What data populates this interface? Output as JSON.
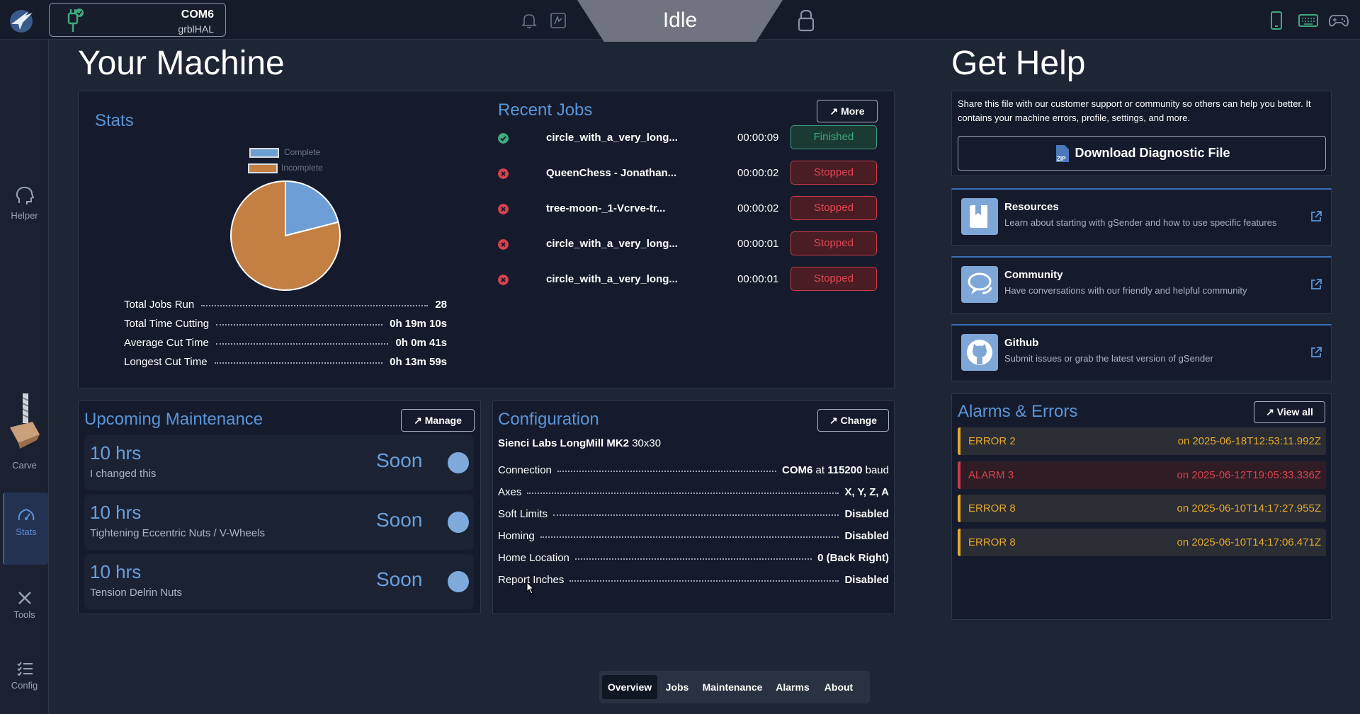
{
  "header": {
    "connection": {
      "port": "COM6",
      "firmware": "grblHAL"
    },
    "state": "Idle"
  },
  "sidebar": {
    "items": [
      {
        "label": "Helper",
        "icon": "helper-icon"
      },
      {
        "label": "Carve",
        "icon": "carve-icon"
      },
      {
        "label": "Stats",
        "icon": "gauge-icon",
        "active": true
      },
      {
        "label": "Tools",
        "icon": "tools-icon"
      },
      {
        "label": "Config",
        "icon": "config-icon"
      }
    ]
  },
  "machine": {
    "title": "Your Machine",
    "stats": {
      "title": "Stats",
      "legend": {
        "complete": "Complete",
        "incomplete": "Incomplete"
      },
      "rows": [
        {
          "label": "Total Jobs Run",
          "value": "28"
        },
        {
          "label": "Total Time Cutting",
          "value": "0h 19m 10s"
        },
        {
          "label": "Average Cut Time",
          "value": "0h 0m 41s"
        },
        {
          "label": "Longest Cut Time",
          "value": "0h 13m 59s"
        }
      ]
    },
    "recent_jobs": {
      "title": "Recent Jobs",
      "more_label": "More",
      "jobs": [
        {
          "name": "circle_with_a_very_long...",
          "time": "00:00:09",
          "status": "Finished"
        },
        {
          "name": "QueenChess - Jonathan...",
          "time": "00:00:02",
          "status": "Stopped"
        },
        {
          "name": "tree-moon-_1-Vcrve-tr...",
          "time": "00:00:02",
          "status": "Stopped"
        },
        {
          "name": "circle_with_a_very_long...",
          "time": "00:00:01",
          "status": "Stopped"
        },
        {
          "name": "circle_with_a_very_long...",
          "time": "00:00:01",
          "status": "Stopped"
        }
      ]
    },
    "maintenance": {
      "title": "Upcoming Maintenance",
      "manage_label": "Manage",
      "items": [
        {
          "hours": "10 hrs",
          "desc": "I changed this",
          "status": "Soon"
        },
        {
          "hours": "10 hrs",
          "desc": "Tightening Eccentric Nuts / V-Wheels",
          "status": "Soon"
        },
        {
          "hours": "10 hrs",
          "desc": "Tension Delrin Nuts",
          "status": "Soon"
        }
      ]
    },
    "configuration": {
      "title": "Configuration",
      "change_label": "Change",
      "machine_name": "Sienci Labs LongMill MK2",
      "machine_size": "30x30",
      "rows": [
        {
          "label": "Connection",
          "value": "COM6",
          "mid": " at ",
          "value2": "115200",
          "suffix": " baud"
        },
        {
          "label": "Axes",
          "value": "X, Y, Z, A"
        },
        {
          "label": "Soft Limits",
          "value": "Disabled"
        },
        {
          "label": "Homing",
          "value": "Disabled"
        },
        {
          "label": "Home Location",
          "value": "0 (Back Right)"
        },
        {
          "label": "Report Inches",
          "value": "Disabled"
        }
      ]
    }
  },
  "tabs": [
    "Overview",
    "Jobs",
    "Maintenance",
    "Alarms",
    "About"
  ],
  "help": {
    "title": "Get Help",
    "diag_text": "Share this file with our customer support or community so others can help you better. It contains your machine errors, profile, settings, and more.",
    "download_label": "Download Diagnostic File",
    "resources": [
      {
        "title": "Resources",
        "desc": "Learn about starting with gSender and how to use specific features",
        "icon": "book-icon"
      },
      {
        "title": "Community",
        "desc": "Have conversations with our friendly and helpful community",
        "icon": "chat-bubbles-icon"
      },
      {
        "title": "Github",
        "desc": "Submit issues or grab the latest version of gSender",
        "icon": "github-icon"
      }
    ]
  },
  "alarms": {
    "title": "Alarms & Errors",
    "view_all_label": "View all",
    "items": [
      {
        "code": "ERROR 2",
        "when": "on 2025-06-18T12:53:11.992Z",
        "kind": "error"
      },
      {
        "code": "ALARM 3",
        "when": "on 2025-06-12T19:05:33.336Z",
        "kind": "alarm"
      },
      {
        "code": "ERROR 8",
        "when": "on 2025-06-10T14:17:27.955Z",
        "kind": "error"
      },
      {
        "code": "ERROR 8",
        "when": "on 2025-06-10T14:17:06.471Z",
        "kind": "error"
      }
    ]
  },
  "chart_data": {
    "type": "pie",
    "categories": [
      "Complete",
      "Incomplete"
    ],
    "values": [
      21,
      79
    ],
    "colors": {
      "Complete": "#6d9fd6",
      "Incomplete": "#c47f43"
    }
  },
  "colors": {
    "accent": "#5b95d8",
    "finished": "#3faa7e",
    "stopped": "#e04754",
    "error": "#e6a92e",
    "alarm": "#d8424e"
  }
}
